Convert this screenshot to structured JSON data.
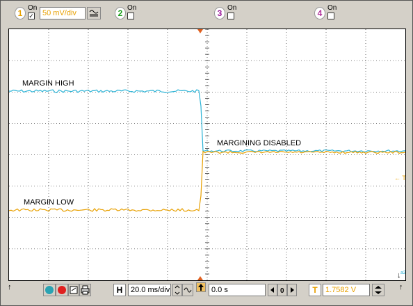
{
  "channels": [
    {
      "number": "1",
      "on_label": "On",
      "checked": true,
      "color": "#e8a000",
      "scale": "50 mV/div"
    },
    {
      "number": "2",
      "on_label": "On",
      "checked": false,
      "color": "#1a9e1a"
    },
    {
      "number": "3",
      "on_label": "On",
      "checked": false,
      "color": "#9a1a9a"
    },
    {
      "number": "4",
      "on_label": "On",
      "checked": false,
      "color": "#b0309a"
    }
  ],
  "annotations": {
    "margin_high": "MARGIN HIGH",
    "margining_disabled": "MARGINING DISABLED",
    "margin_low": "MARGIN LOW"
  },
  "markers": {
    "trigger_label": "← T",
    "ref_label": "↓",
    "ref_sub": "a2"
  },
  "toolbar": {
    "horizontal_label": "H",
    "timebase": "20.0 ms/div",
    "position": "0.0 s",
    "trigger_label": "T",
    "trigger_level": "1.7582 V"
  },
  "colors": {
    "trace_cyan": "#2bb3d6",
    "trace_orange": "#e8a000",
    "grid": "#000000",
    "panel": "#d4d0c8",
    "marker": "#e06020"
  }
}
